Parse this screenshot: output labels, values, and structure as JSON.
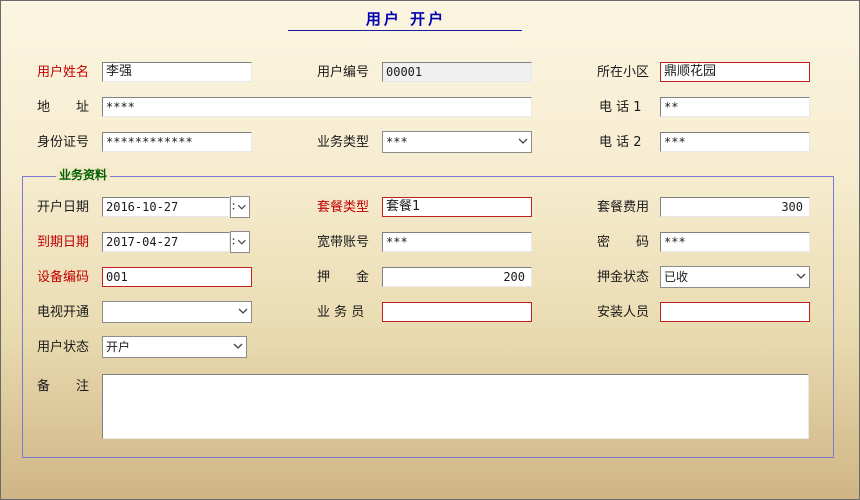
{
  "window": {
    "title": "用户 开户"
  },
  "labels": {
    "user_name": "用户姓名",
    "user_id": "用户编号",
    "community": "所在小区",
    "address": "地　　址",
    "phone1": "电 话 1",
    "id_card": "身份证号",
    "service_type": "业务类型",
    "phone2": "电 话 2",
    "group_title": "业务资料",
    "open_date": "开户日期",
    "package_type": "套餐类型",
    "package_fee": "套餐费用",
    "expire_date": "到期日期",
    "broadband_account": "宽带账号",
    "password": "密　　码",
    "device_code": "设备编码",
    "deposit": "押　　金",
    "deposit_status": "押金状态",
    "tv_enabled": "电视开通",
    "salesman": "业 务 员",
    "installer": "安装人员",
    "user_status": "用户状态",
    "remark": "备　　注"
  },
  "fields": {
    "user_name": "李强",
    "user_id": "00001",
    "community": "鼎顺花园",
    "address": "****",
    "phone1": "**",
    "id_card": "************",
    "service_type": "***",
    "phone2": "***",
    "open_date": "2016-10-27",
    "package_type": "套餐1",
    "package_fee": "300",
    "expire_date": "2017-04-27",
    "broadband_account": "***",
    "password": "***",
    "device_code": "001",
    "deposit": "200",
    "deposit_status": "已收",
    "tv_enabled": "",
    "salesman": "",
    "installer": "",
    "user_status": "开户",
    "remark": ""
  },
  "colors": {
    "title": "#0000b0",
    "required_label": "#c00000",
    "group_title": "#006000",
    "group_border": "#7a7ad0",
    "required_border": "#c02020"
  },
  "icons": {
    "combo": "chevron-down-icon",
    "date_picker": "date-picker-icon"
  }
}
